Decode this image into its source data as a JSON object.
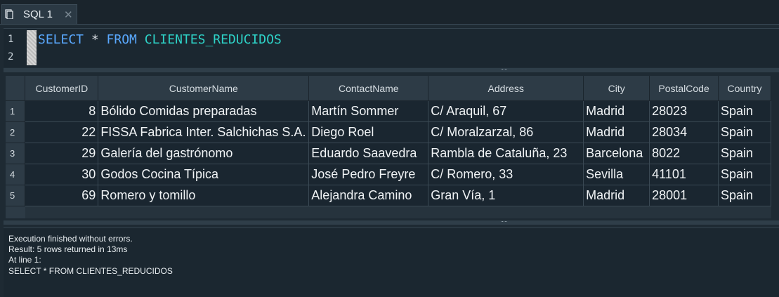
{
  "tab": {
    "label": "SQL 1",
    "close_glyph": "✕",
    "icon": "sql-file-icon"
  },
  "editor": {
    "line_numbers": [
      "1",
      "2"
    ],
    "tokens": {
      "select": "SELECT",
      "star": " * ",
      "from": "FROM",
      "space": " ",
      "table": "CLIENTES_REDUCIDOS"
    }
  },
  "results": {
    "columns": [
      "CustomerID",
      "CustomerName",
      "ContactName",
      "Address",
      "City",
      "PostalCode",
      "Country"
    ],
    "rows": [
      {
        "num": "1",
        "cells": [
          "8",
          "Bólido Comidas preparadas",
          "Martín Sommer",
          "C/ Araquil, 67",
          "Madrid",
          "28023",
          "Spain"
        ]
      },
      {
        "num": "2",
        "cells": [
          "22",
          "FISSA Fabrica Inter. Salchichas S.A.",
          "Diego Roel",
          "C/ Moralzarzal, 86",
          "Madrid",
          "28034",
          "Spain"
        ]
      },
      {
        "num": "3",
        "cells": [
          "29",
          "Galería del gastrónomo",
          "Eduardo Saavedra",
          "Rambla de Cataluña, 23",
          "Barcelona",
          "8022",
          "Spain"
        ]
      },
      {
        "num": "4",
        "cells": [
          "30",
          "Godos Cocina Típica",
          "José Pedro Freyre",
          "C/ Romero, 33",
          "Sevilla",
          "41101",
          "Spain"
        ]
      },
      {
        "num": "5",
        "cells": [
          "69",
          "Romero y tomillo",
          "Alejandra Camino",
          "Gran Vía, 1",
          "Madrid",
          "28001",
          "Spain"
        ]
      }
    ]
  },
  "messages": {
    "lines": [
      "Execution finished without errors.",
      "Result: 5 rows returned in 13ms",
      "At line 1:",
      "SELECT * FROM CLIENTES_REDUCIDOS"
    ]
  },
  "colors": {
    "keyword": "#5aa9ff",
    "table_name": "#2ed3c8",
    "background": "#1e2a33"
  }
}
